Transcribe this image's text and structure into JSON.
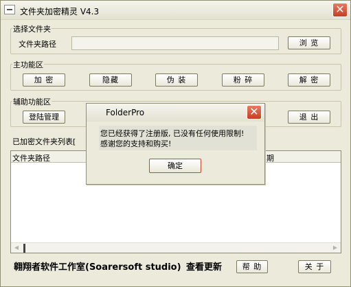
{
  "window": {
    "title": "文件夹加密精灵 V4.3"
  },
  "select_group": {
    "label": "选择文件夹",
    "path_label": "文件夹路径",
    "path_value": "",
    "browse_label": "浏 览"
  },
  "main_group": {
    "label": "主功能区",
    "buttons": [
      "加 密",
      "隐藏",
      "伪 装",
      "粉 碎",
      "解 密"
    ]
  },
  "aux_group": {
    "label": "辅助功能区",
    "login_label": "登陆管理",
    "exit_label": "退 出"
  },
  "list_group": {
    "label": "已加密文件夹列表[",
    "columns": [
      "文件夹路径",
      "期"
    ]
  },
  "footer": {
    "studio": "翱翔者软件工作室(Soarersoft studio)",
    "check_update": "查看更新",
    "help_label": "帮 助",
    "about_label": "关 于"
  },
  "dialog": {
    "title": "FolderPro",
    "message_line1": "您已经获得了注册版, 已没有任何使用限制!",
    "message_line2": "感谢您的支持和购买!",
    "ok_label": "确定"
  },
  "icons": {
    "window_icon": "system-menu-icon",
    "close": "close-icon",
    "scroll_left": "arrow-left-icon",
    "scroll_right": "arrow-right-icon"
  }
}
